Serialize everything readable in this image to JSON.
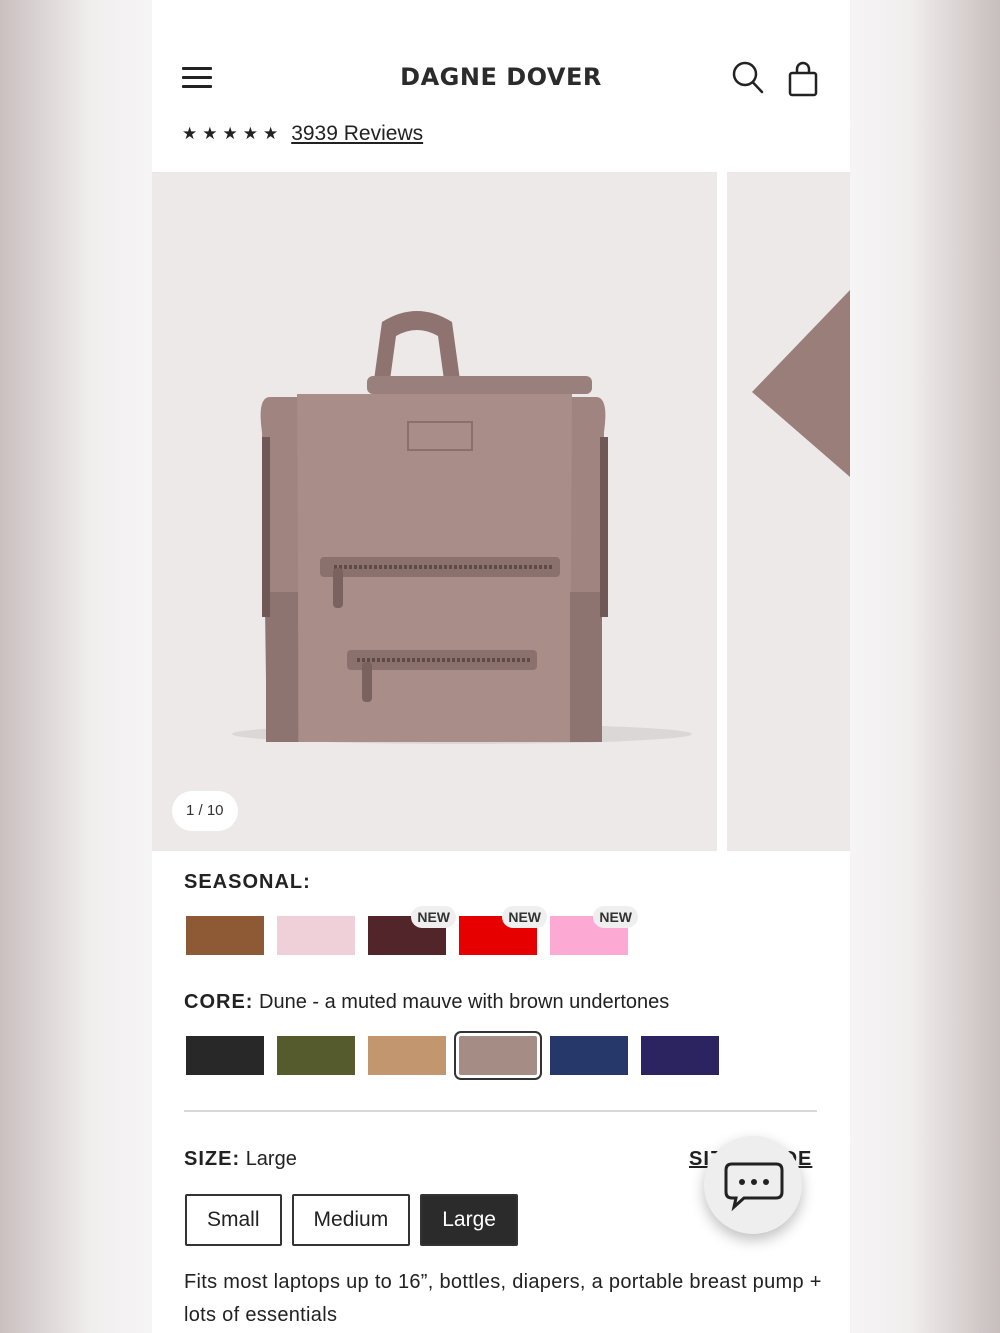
{
  "brand": {
    "logo_text": "DAGNE DOVER"
  },
  "header": {
    "menu_icon": "hamburger-menu-icon",
    "search_icon": "search-icon",
    "bag_icon": "shopping-bag-icon"
  },
  "reviews": {
    "stars": "★★★★★",
    "rating_stars": 5,
    "link_text": "3939 Reviews"
  },
  "gallery": {
    "counter": "1 / 10",
    "current": 1,
    "total": 10
  },
  "seasonal": {
    "label": "SEASONAL:",
    "swatches": [
      {
        "color": "#8e5a35",
        "badge": ""
      },
      {
        "color": "#f0d0d8",
        "badge": ""
      },
      {
        "color": "#52252a",
        "badge": "NEW"
      },
      {
        "color": "#e60000",
        "badge": "NEW"
      },
      {
        "color": "#fca9d3",
        "badge": "NEW"
      }
    ]
  },
  "core": {
    "label": "CORE:",
    "selected_name": "Dune - a muted mauve with brown undertones",
    "swatches": [
      {
        "color": "#282828",
        "selected": false
      },
      {
        "color": "#565b2e",
        "selected": false
      },
      {
        "color": "#c2966e",
        "selected": false
      },
      {
        "color": "#a58c85",
        "selected": true
      },
      {
        "color": "#26386a",
        "selected": false
      },
      {
        "color": "#2b2460",
        "selected": false
      }
    ]
  },
  "size": {
    "label": "SIZE:",
    "selected": "Large",
    "guide_text": "SIZE GUIDE",
    "options": [
      "Small",
      "Medium",
      "Large"
    ]
  },
  "description": "Fits most laptops up to 16”, bottles, diapers, a portable breast pump + lots of essentials",
  "chat": {
    "icon": "chat-bubble-icon"
  }
}
